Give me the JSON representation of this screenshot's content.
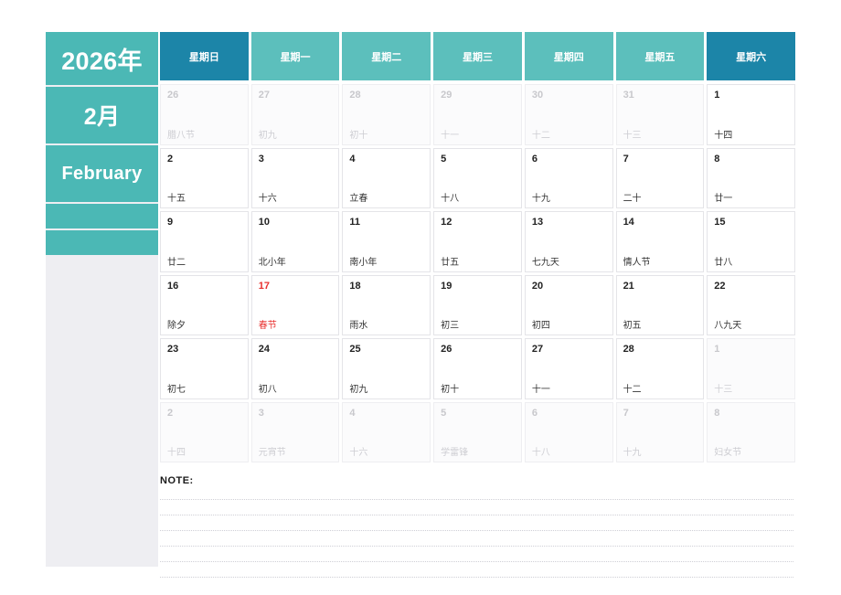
{
  "sidebar": {
    "year_label": "2026年",
    "month_label": "2月",
    "english_month": "February",
    "empty_blocks": [
      "",
      ""
    ]
  },
  "weekdays": [
    {
      "label": "星期日",
      "weekend": true
    },
    {
      "label": "星期一",
      "weekend": false
    },
    {
      "label": "星期二",
      "weekend": false
    },
    {
      "label": "星期三",
      "weekend": false
    },
    {
      "label": "星期四",
      "weekend": false
    },
    {
      "label": "星期五",
      "weekend": false
    },
    {
      "label": "星期六",
      "weekend": true
    }
  ],
  "colors": {
    "teal": "#4bb8b5",
    "teal_header": "#5cbfbc",
    "teal_dark": "#1c85a8",
    "holiday_red": "#e8312f",
    "sidebar_grey": "#eeeef2"
  },
  "days": [
    {
      "num": "26",
      "lunar": "腊八节",
      "muted": true,
      "holiday": false
    },
    {
      "num": "27",
      "lunar": "初九",
      "muted": true,
      "holiday": false
    },
    {
      "num": "28",
      "lunar": "初十",
      "muted": true,
      "holiday": false
    },
    {
      "num": "29",
      "lunar": "十一",
      "muted": true,
      "holiday": false
    },
    {
      "num": "30",
      "lunar": "十二",
      "muted": true,
      "holiday": false
    },
    {
      "num": "31",
      "lunar": "十三",
      "muted": true,
      "holiday": false
    },
    {
      "num": "1",
      "lunar": "十四",
      "muted": false,
      "holiday": false
    },
    {
      "num": "2",
      "lunar": "十五",
      "muted": false,
      "holiday": false
    },
    {
      "num": "3",
      "lunar": "十六",
      "muted": false,
      "holiday": false
    },
    {
      "num": "4",
      "lunar": "立春",
      "muted": false,
      "holiday": false
    },
    {
      "num": "5",
      "lunar": "十八",
      "muted": false,
      "holiday": false
    },
    {
      "num": "6",
      "lunar": "十九",
      "muted": false,
      "holiday": false
    },
    {
      "num": "7",
      "lunar": "二十",
      "muted": false,
      "holiday": false
    },
    {
      "num": "8",
      "lunar": "廿一",
      "muted": false,
      "holiday": false
    },
    {
      "num": "9",
      "lunar": "廿二",
      "muted": false,
      "holiday": false
    },
    {
      "num": "10",
      "lunar": "北小年",
      "muted": false,
      "holiday": false
    },
    {
      "num": "11",
      "lunar": "南小年",
      "muted": false,
      "holiday": false
    },
    {
      "num": "12",
      "lunar": "廿五",
      "muted": false,
      "holiday": false
    },
    {
      "num": "13",
      "lunar": "七九天",
      "muted": false,
      "holiday": false
    },
    {
      "num": "14",
      "lunar": "情人节",
      "muted": false,
      "holiday": false
    },
    {
      "num": "15",
      "lunar": "廿八",
      "muted": false,
      "holiday": false
    },
    {
      "num": "16",
      "lunar": "除夕",
      "muted": false,
      "holiday": false
    },
    {
      "num": "17",
      "lunar": "春节",
      "muted": false,
      "holiday": true
    },
    {
      "num": "18",
      "lunar": "雨水",
      "muted": false,
      "holiday": false
    },
    {
      "num": "19",
      "lunar": "初三",
      "muted": false,
      "holiday": false
    },
    {
      "num": "20",
      "lunar": "初四",
      "muted": false,
      "holiday": false
    },
    {
      "num": "21",
      "lunar": "初五",
      "muted": false,
      "holiday": false
    },
    {
      "num": "22",
      "lunar": "八九天",
      "muted": false,
      "holiday": false
    },
    {
      "num": "23",
      "lunar": "初七",
      "muted": false,
      "holiday": false
    },
    {
      "num": "24",
      "lunar": "初八",
      "muted": false,
      "holiday": false
    },
    {
      "num": "25",
      "lunar": "初九",
      "muted": false,
      "holiday": false
    },
    {
      "num": "26",
      "lunar": "初十",
      "muted": false,
      "holiday": false
    },
    {
      "num": "27",
      "lunar": "十一",
      "muted": false,
      "holiday": false
    },
    {
      "num": "28",
      "lunar": "十二",
      "muted": false,
      "holiday": false
    },
    {
      "num": "1",
      "lunar": "十三",
      "muted": true,
      "holiday": false
    },
    {
      "num": "2",
      "lunar": "十四",
      "muted": true,
      "holiday": false
    },
    {
      "num": "3",
      "lunar": "元宵节",
      "muted": true,
      "holiday": false
    },
    {
      "num": "4",
      "lunar": "十六",
      "muted": true,
      "holiday": false
    },
    {
      "num": "5",
      "lunar": "学雷锋",
      "muted": true,
      "holiday": false
    },
    {
      "num": "6",
      "lunar": "十八",
      "muted": true,
      "holiday": false
    },
    {
      "num": "7",
      "lunar": "十九",
      "muted": true,
      "holiday": false
    },
    {
      "num": "8",
      "lunar": "妇女节",
      "muted": true,
      "holiday": false
    }
  ],
  "note": {
    "label": "NOTE:",
    "line_count": 6
  }
}
